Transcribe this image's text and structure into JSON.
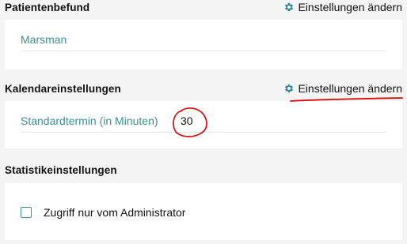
{
  "patient_report": {
    "title": "Patientenbefund",
    "settings_label": "Einstellungen ändern",
    "field_value": "Marsman"
  },
  "calendar_settings": {
    "title": "Kalendareinstellungen",
    "settings_label": "Einstellungen ändern",
    "field_label": "Standardtermin (in Minuten)",
    "field_value": "30"
  },
  "statistics_settings": {
    "title": "Statistikeinstellungen",
    "checkbox_label": "Zugriff nur vom Administrator"
  },
  "colors": {
    "accent": "#3f8f92",
    "annotation": "#e00000",
    "gear": "#2f8a8c"
  }
}
